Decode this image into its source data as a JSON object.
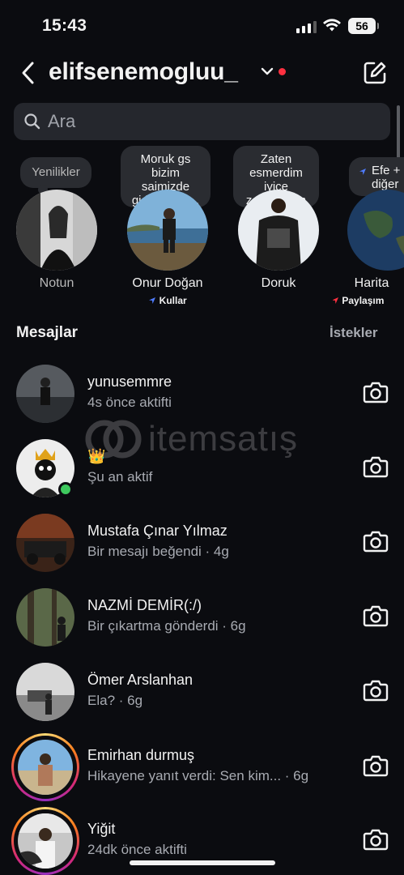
{
  "status_bar": {
    "time": "15:43",
    "battery": "56"
  },
  "header": {
    "username": "elifsenemogluu_"
  },
  "search": {
    "placeholder": "Ara"
  },
  "notes": [
    {
      "bubble": "Yenilikler",
      "name": "Notun",
      "sub": ""
    },
    {
      "bubble": "Moruk gs bizim saimizde gidiyonız ş...",
      "name": "Onur Doğan",
      "sub": "Kullar"
    },
    {
      "bubble": "Zaten esmerdim iyice zencileştim",
      "name": "Doruk",
      "sub": ""
    },
    {
      "bubble": "Efe + diğer",
      "name": "Harita",
      "sub": "Paylaşım"
    }
  ],
  "messages_title": "Mesajlar",
  "requests_label": "İstekler",
  "watermark": "itemsatış",
  "conversations": [
    {
      "name": "yunusemmre",
      "subtitle": "4s önce aktifti",
      "online": false,
      "story": false
    },
    {
      "name": "👑",
      "subtitle": "Şu an aktif",
      "online": true,
      "story": false
    },
    {
      "name": "Mustafa Çınar Yılmaz",
      "subtitle": "Bir mesajı beğendi · 4g",
      "online": false,
      "story": false
    },
    {
      "name": "NAZMİ DEMİR(:/)",
      "subtitle": "Bir çıkartma gönderdi · 6g",
      "online": false,
      "story": false
    },
    {
      "name": "Ömer Arslanhan",
      "subtitle": "Ela? · 6g",
      "online": false,
      "story": false
    },
    {
      "name": "Emirhan durmuş",
      "subtitle": "Hikayene yanıt verdi: Sen kim... · 6g",
      "online": false,
      "story": true
    },
    {
      "name": "Yiğit",
      "subtitle": "24dk önce aktifti",
      "online": false,
      "story": true
    }
  ]
}
